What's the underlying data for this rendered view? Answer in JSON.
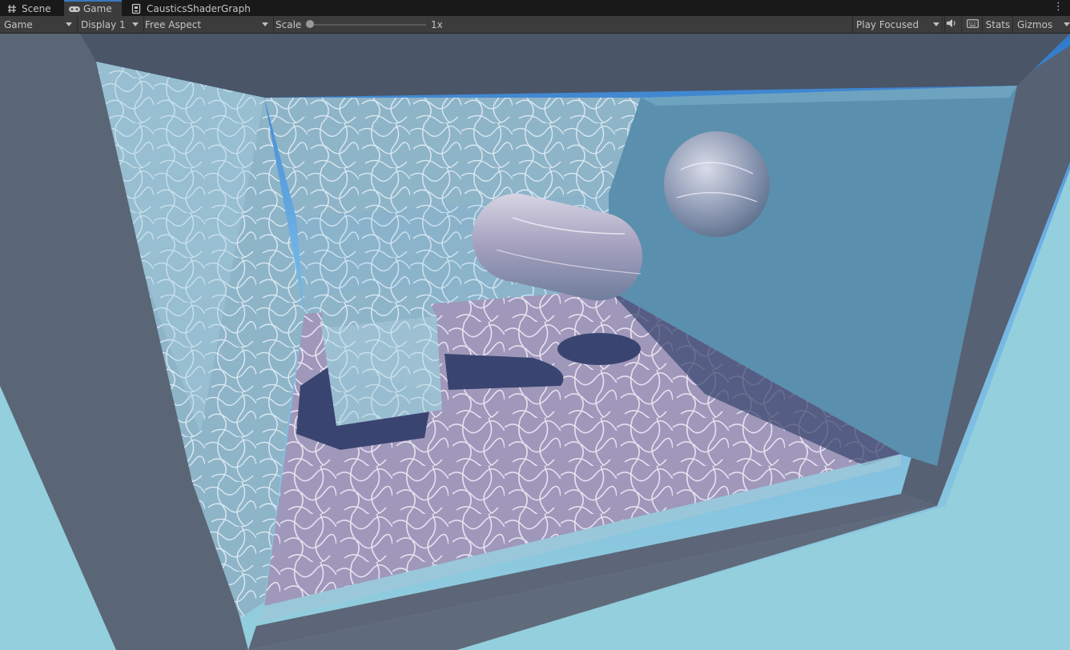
{
  "tabs": [
    {
      "label": "Scene",
      "icon": "grid-hash-icon",
      "active": false
    },
    {
      "label": "Game",
      "icon": "gamepad-icon",
      "active": true
    },
    {
      "label": "CausticsShaderGraph",
      "icon": "shader-graph-icon",
      "active": false
    }
  ],
  "toolbar": {
    "view_mode": "Game",
    "display": "Display 1",
    "aspect": "Free Aspect",
    "scale_label": "Scale",
    "scale_value": "1x",
    "scale_level": 0,
    "play_mode": "Play Focused",
    "audio_icon": "speaker-icon",
    "keyboard_icon": "keyboard-icon",
    "stats_label": "Stats",
    "gizmos_label": "Gizmos"
  },
  "colors": {
    "active_tab_accent": "#3a79bb",
    "toolbar_bg": "#3c3c3c",
    "tabbar_bg": "#191919",
    "sky": "#8fcbd9",
    "room_wall": "#555e6e",
    "floor_caustics": "#a9a2c2",
    "glass": "#6fa9c4"
  }
}
